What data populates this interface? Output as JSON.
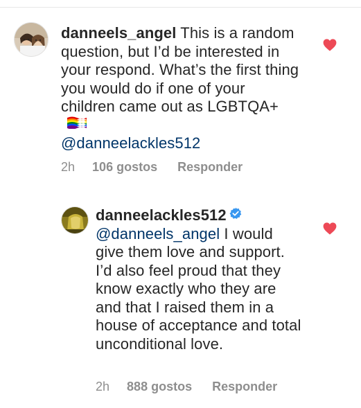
{
  "comments": [
    {
      "username": "danneels_angel",
      "text": "This is a random question, but I’d be interested in your respond. What’s the first thing you would do if one of your children came out as LGBTQA+",
      "flag_icon": "rainbow-flag-icon",
      "mention": "@danneelackles512",
      "time": "2h",
      "likes": "106 gostos",
      "reply": "Responder",
      "liked": true
    },
    {
      "username": "danneelackles512",
      "verified": true,
      "mention": "@danneels_angel",
      "text": "I would give them love and support. I’d also feel proud that they know exactly who they are and that I raised them in a house of acceptance and total unconditional love.",
      "time": "2h",
      "likes": "888 gostos",
      "reply": "Responder",
      "liked": true
    }
  ],
  "colors": {
    "text": "#262626",
    "mention": "#003569",
    "meta": "#8e8e8e",
    "heart": "#ed4956",
    "verified": "#3897f0"
  }
}
